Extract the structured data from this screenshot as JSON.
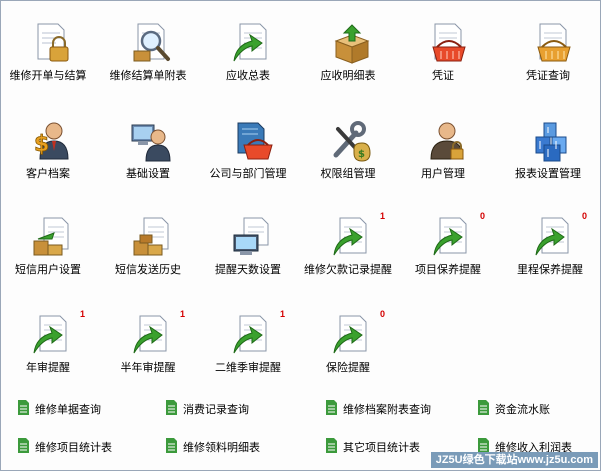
{
  "tiles": [
    {
      "label": "维修开单与结算",
      "icon": "doc-lock-icon",
      "badge": ""
    },
    {
      "label": "维修结算单附表",
      "icon": "doc-search-icon",
      "badge": ""
    },
    {
      "label": "应收总表",
      "icon": "doc-arrow-icon",
      "badge": ""
    },
    {
      "label": "应收明细表",
      "icon": "box-arrow-icon",
      "badge": ""
    },
    {
      "label": "凭证",
      "icon": "doc-basket-icon",
      "badge": ""
    },
    {
      "label": "凭证查询",
      "icon": "doc-basket-icon",
      "badge": ""
    },
    {
      "label": "客户档案",
      "icon": "person-dollar-icon",
      "badge": ""
    },
    {
      "label": "基础设置",
      "icon": "person-computer-icon",
      "badge": ""
    },
    {
      "label": "公司与部门管理",
      "icon": "book-basket-icon",
      "badge": ""
    },
    {
      "label": "权限组管理",
      "icon": "tools-money-icon",
      "badge": ""
    },
    {
      "label": "用户管理",
      "icon": "person-lock-icon",
      "badge": ""
    },
    {
      "label": "报表设置管理",
      "icon": "cubes-icon",
      "badge": ""
    },
    {
      "label": "短信用户设置",
      "icon": "doc-boxes-icon",
      "badge": ""
    },
    {
      "label": "短信发送历史",
      "icon": "doc-boxes-icon",
      "badge": ""
    },
    {
      "label": "提醒天数设置",
      "icon": "doc-monitor-icon",
      "badge": ""
    },
    {
      "label": "维修欠款记录提醒",
      "icon": "doc-arrow-icon",
      "badge": "1"
    },
    {
      "label": "项目保养提醒",
      "icon": "doc-arrow-icon",
      "badge": "0"
    },
    {
      "label": "里程保养提醒",
      "icon": "doc-arrow-icon",
      "badge": "0"
    },
    {
      "label": "年审提醒",
      "icon": "doc-arrow-icon",
      "badge": "1"
    },
    {
      "label": "半年审提醒",
      "icon": "doc-arrow-icon",
      "badge": "1"
    },
    {
      "label": "二维季审提醒",
      "icon": "doc-arrow-icon",
      "badge": "1"
    },
    {
      "label": "保险提醒",
      "icon": "doc-arrow-icon",
      "badge": "0"
    }
  ],
  "links": [
    {
      "label": "维修单据查询",
      "icon": "green-doc-icon"
    },
    {
      "label": "消费记录查询",
      "icon": "green-doc-icon"
    },
    {
      "label": "维修档案附表查询",
      "icon": "green-doc-icon"
    },
    {
      "label": "资金流水账",
      "icon": "green-doc-icon"
    },
    {
      "label": "维修项目统计表",
      "icon": "green-doc-icon"
    },
    {
      "label": "维修领料明细表",
      "icon": "green-doc-icon"
    },
    {
      "label": "其它项目统计表",
      "icon": "green-doc-icon"
    },
    {
      "label": "维修收入利润表",
      "icon": "green-doc-icon"
    }
  ],
  "watermark": "JZ5U绿色下载站www.jz5u.com",
  "colors": {
    "badge": "#d40000",
    "arrow": "#3aa12e",
    "doc": "#ffffff",
    "link_doc": "#3c9a3c",
    "frame": "#9aa7b8"
  }
}
